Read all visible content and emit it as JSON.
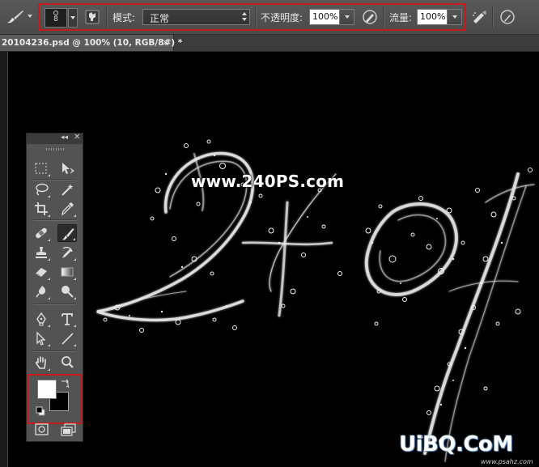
{
  "options_bar": {
    "brush_size": "8",
    "mode_label": "模式:",
    "mode_value": "正常",
    "opacity_label": "不透明度:",
    "opacity_value": "100%",
    "flow_label": "流量:",
    "flow_value": "100%",
    "highlight_color": "#c8191b"
  },
  "document_tab": {
    "title": "20104236.psd @ 100% (10, RGB/8#) *",
    "close_glyph": "×"
  },
  "canvas": {
    "watermark": "www.240PS.com",
    "brand_mark": "UiBQ.CoM",
    "site_url": "www.psahz.com"
  },
  "toolbox": {
    "collapse_glyph": "◂◂",
    "close_glyph": "✕",
    "tools": [
      {
        "name": "marquee-tool",
        "icon": "dashed-rect-icon"
      },
      {
        "name": "move-tool",
        "icon": "move-arrow-icon"
      },
      {
        "name": "lasso-tool",
        "icon": "lasso-icon"
      },
      {
        "name": "magic-wand-tool",
        "icon": "wand-icon"
      },
      {
        "name": "crop-tool",
        "icon": "crop-icon"
      },
      {
        "name": "eyedropper-tool",
        "icon": "eyedropper-icon"
      },
      {
        "name": "healing-brush-tool",
        "icon": "bandage-icon"
      },
      {
        "name": "brush-tool",
        "icon": "brush-icon",
        "active": true
      },
      {
        "name": "clone-stamp-tool",
        "icon": "stamp-icon"
      },
      {
        "name": "history-brush-tool",
        "icon": "history-brush-icon"
      },
      {
        "name": "eraser-tool",
        "icon": "eraser-icon"
      },
      {
        "name": "gradient-tool",
        "icon": "gradient-icon"
      },
      {
        "name": "blur-tool",
        "icon": "drop-icon"
      },
      {
        "name": "dodge-tool",
        "icon": "dodge-icon"
      },
      {
        "name": "pen-tool",
        "icon": "pen-icon"
      },
      {
        "name": "type-tool",
        "icon": "type-icon",
        "glyph": "T"
      },
      {
        "name": "path-selection-tool",
        "icon": "arrow-icon"
      },
      {
        "name": "line-tool",
        "icon": "line-icon"
      },
      {
        "name": "hand-tool",
        "icon": "hand-icon"
      },
      {
        "name": "zoom-tool",
        "icon": "magnifier-icon"
      }
    ],
    "foreground_color": "#ffffff",
    "background_color": "#000000"
  }
}
